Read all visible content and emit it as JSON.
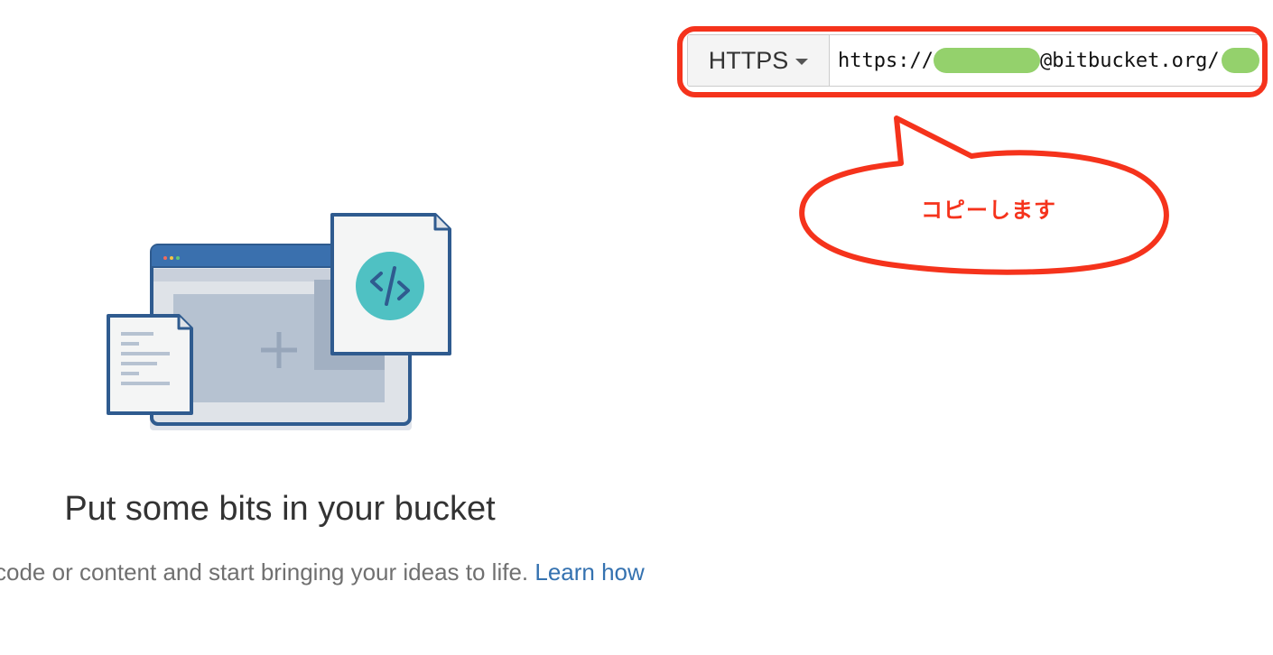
{
  "clone": {
    "protocol": "HTTPS",
    "url_prefix": "https://",
    "url_middle": "@bitbucket.org/"
  },
  "annotation": {
    "callout_text": "コピーします",
    "color": "#f5331c"
  },
  "empty_state": {
    "title": "Put some bits in your bucket",
    "description": "code or content and start bringing your ideas to life.",
    "link_text": "Learn how"
  },
  "colors": {
    "link": "#3572b0",
    "redaction": "#94d16c",
    "illustration_blue": "#2f5b8f",
    "illustration_teal": "#4fc1c3"
  }
}
